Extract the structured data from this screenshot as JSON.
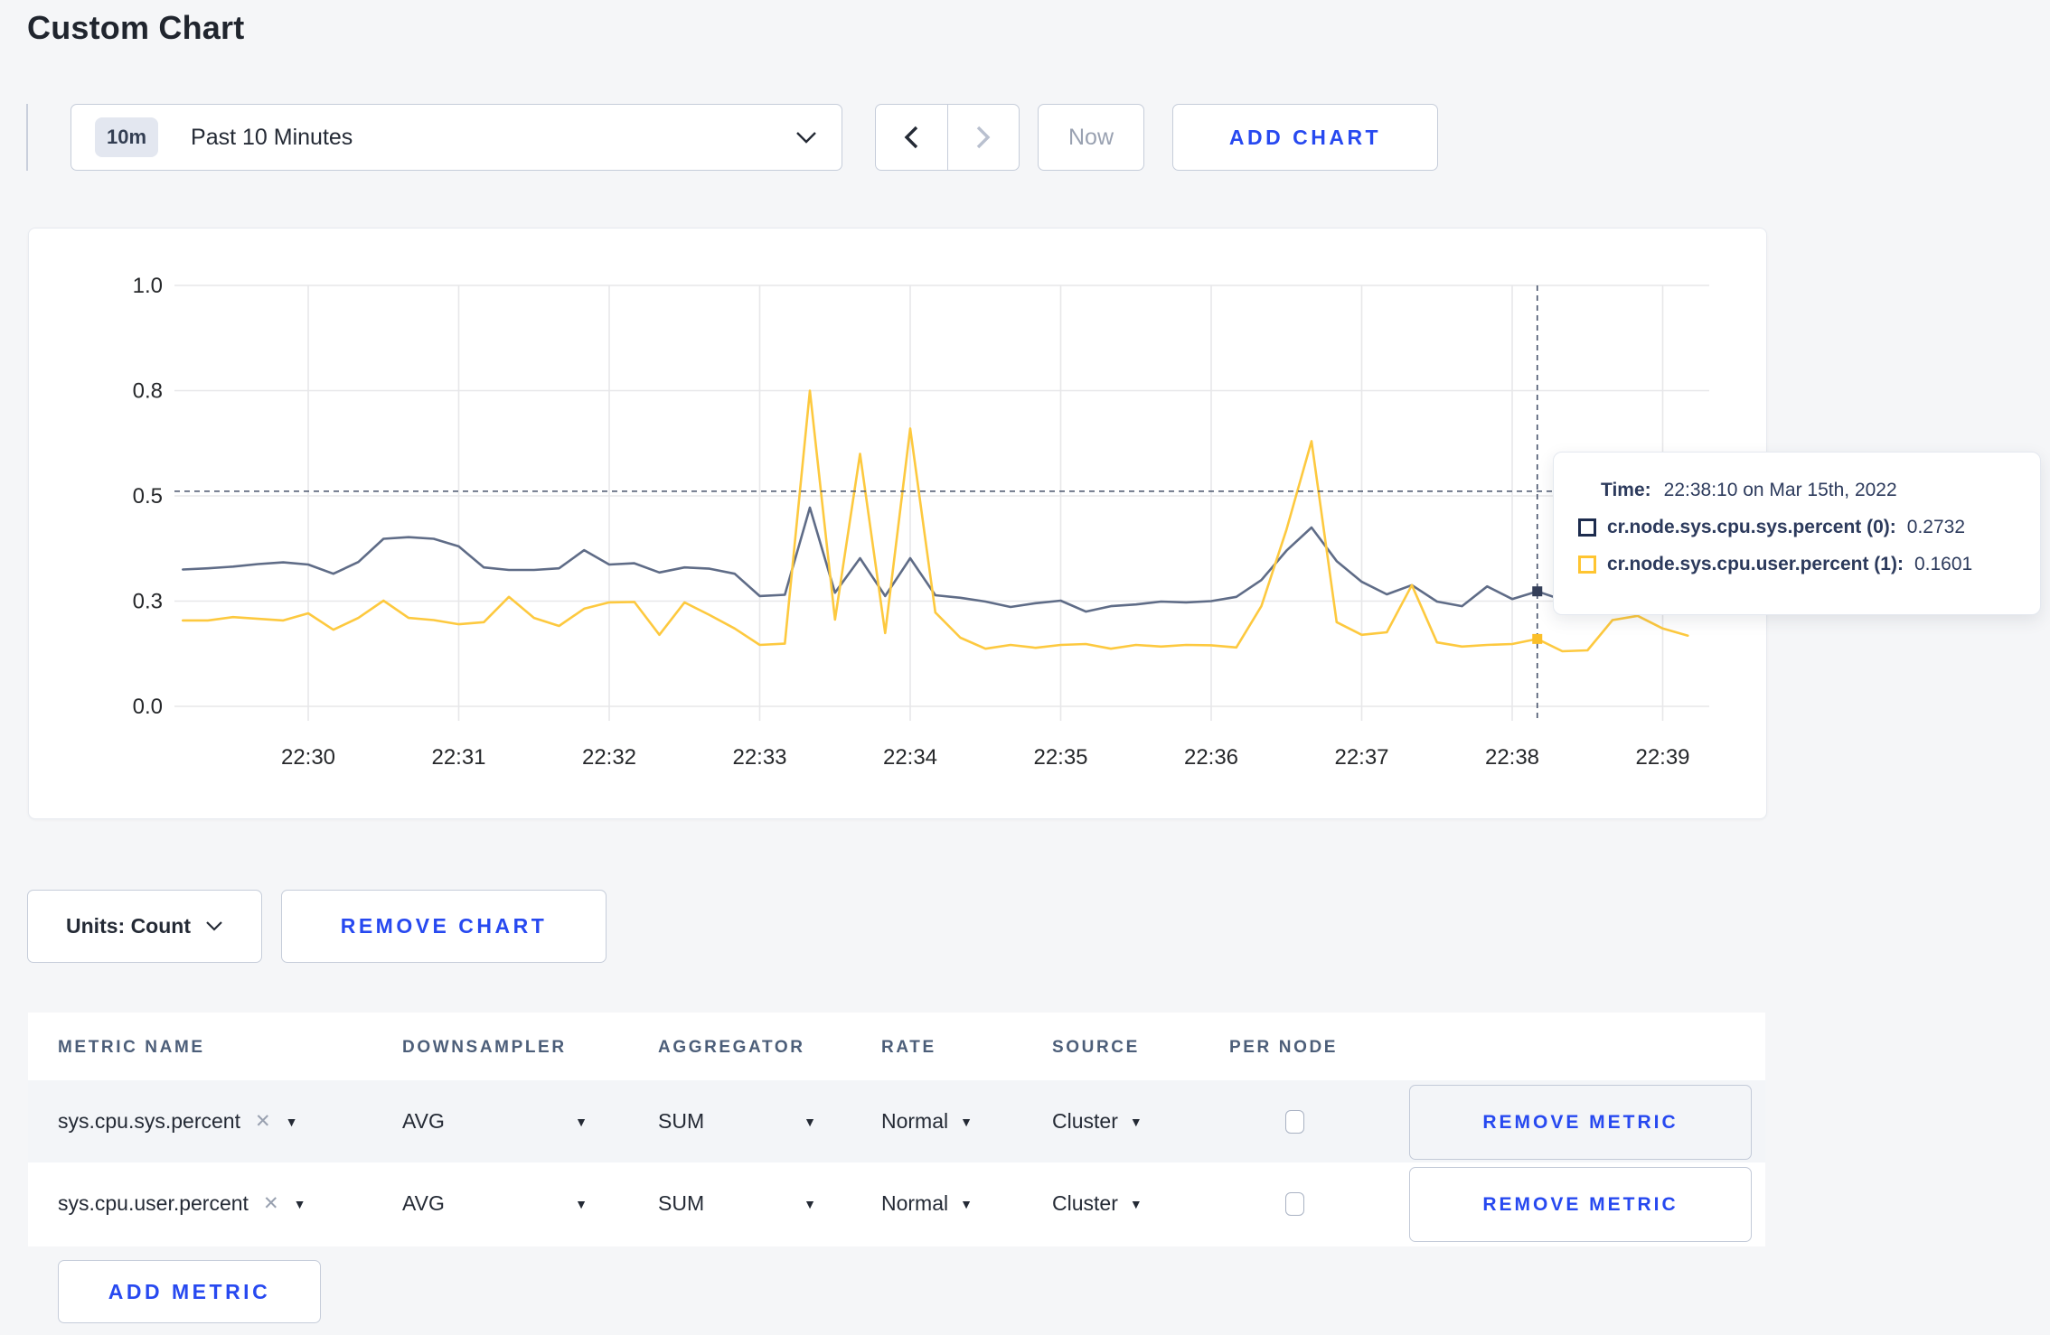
{
  "page": {
    "title": "Custom Chart"
  },
  "colors": {
    "accent_blue": "#2749f0",
    "series_sys": "#5f6c87",
    "series_user": "#fdc93f",
    "navy_text": "#2c3a5c",
    "page_background": "#f5f6f8"
  },
  "toolbar": {
    "time_range": {
      "badge": "10m",
      "label": "Past 10 Minutes"
    },
    "now_label": "Now",
    "add_chart_label": "ADD CHART"
  },
  "tooltip": {
    "time_label": "Time:",
    "time_value": "22:38:10 on Mar 15th, 2022",
    "series": [
      {
        "name": "cr.node.sys.cpu.sys.percent (0):",
        "value": "0.2732",
        "color": "#1d2c4e"
      },
      {
        "name": "cr.node.sys.cpu.user.percent (1):",
        "value": "0.1601",
        "color": "#ffc531"
      }
    ]
  },
  "units_bar": {
    "units_label": "Units: Count",
    "remove_chart_label": "REMOVE CHART"
  },
  "metrics_table": {
    "headers": [
      "METRIC NAME",
      "DOWNSAMPLER",
      "AGGREGATOR",
      "RATE",
      "SOURCE",
      "PER NODE"
    ],
    "rows": [
      {
        "metric": "sys.cpu.sys.percent",
        "downsampler": "AVG",
        "aggregator": "SUM",
        "rate": "Normal",
        "source": "Cluster",
        "per_node_checked": false,
        "remove_label": "REMOVE METRIC"
      },
      {
        "metric": "sys.cpu.user.percent",
        "downsampler": "AVG",
        "aggregator": "SUM",
        "rate": "Normal",
        "source": "Cluster",
        "per_node_checked": false,
        "remove_label": "REMOVE METRIC"
      }
    ],
    "add_metric_label": "ADD METRIC"
  },
  "chart_data": {
    "type": "line",
    "title": "",
    "xlabel": "",
    "ylabel": "",
    "ylim": [
      0,
      1
    ],
    "grid": true,
    "legend_position": "none",
    "x_start": "22:29:10",
    "interval_seconds": 10,
    "x_ticks": [
      "22:30",
      "22:31",
      "22:32",
      "22:33",
      "22:34",
      "22:35",
      "22:36",
      "22:37",
      "22:38",
      "22:39"
    ],
    "y_ticks": [
      {
        "v": 0.0,
        "label": "0.0"
      },
      {
        "v": 0.25,
        "label": "0.3"
      },
      {
        "v": 0.5,
        "label": "0.5"
      },
      {
        "v": 0.75,
        "label": "0.8"
      },
      {
        "v": 1.0,
        "label": "1.0"
      }
    ],
    "series": [
      {
        "name": "cr.node.sys.cpu.sys.percent (0)",
        "color": "#5f6c87",
        "marker_color": "#343f59",
        "values": [
          0.325,
          0.328,
          0.332,
          0.338,
          0.342,
          0.337,
          0.315,
          0.343,
          0.398,
          0.402,
          0.398,
          0.38,
          0.33,
          0.324,
          0.324,
          0.328,
          0.371,
          0.337,
          0.34,
          0.318,
          0.33,
          0.327,
          0.315,
          0.262,
          0.265,
          0.472,
          0.27,
          0.352,
          0.262,
          0.352,
          0.264,
          0.258,
          0.249,
          0.236,
          0.245,
          0.251,
          0.225,
          0.238,
          0.242,
          0.249,
          0.247,
          0.25,
          0.26,
          0.3,
          0.37,
          0.425,
          0.345,
          0.296,
          0.266,
          0.288,
          0.249,
          0.238,
          0.285,
          0.255,
          0.2732,
          0.253,
          0.262,
          0.27,
          0.28,
          0.28,
          0.28
        ]
      },
      {
        "name": "cr.node.sys.cpu.user.percent (1)",
        "color": "#fdc93f",
        "marker_color": "#fbbf29",
        "values": [
          0.204,
          0.204,
          0.212,
          0.208,
          0.204,
          0.221,
          0.182,
          0.21,
          0.251,
          0.21,
          0.205,
          0.195,
          0.2,
          0.26,
          0.21,
          0.191,
          0.232,
          0.247,
          0.248,
          0.17,
          0.247,
          0.217,
          0.185,
          0.146,
          0.149,
          0.75,
          0.206,
          0.6,
          0.174,
          0.66,
          0.223,
          0.163,
          0.137,
          0.146,
          0.139,
          0.146,
          0.148,
          0.137,
          0.146,
          0.142,
          0.146,
          0.145,
          0.14,
          0.238,
          0.42,
          0.63,
          0.2,
          0.17,
          0.176,
          0.288,
          0.152,
          0.142,
          0.146,
          0.148,
          0.1601,
          0.131,
          0.133,
          0.205,
          0.215,
          0.185,
          0.168
        ]
      }
    ],
    "crosshair": {
      "time": "22:38:10",
      "index": 54,
      "h_line_value": 0.511
    }
  }
}
